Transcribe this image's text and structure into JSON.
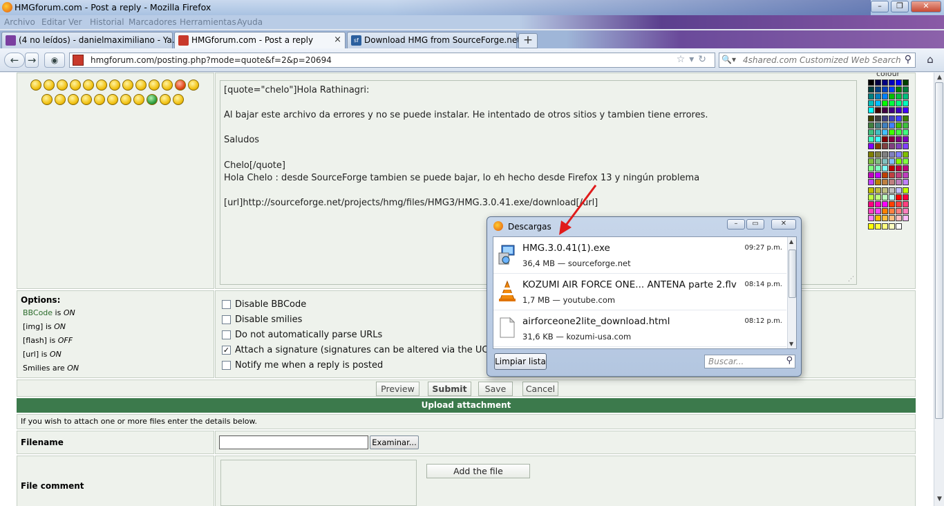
{
  "window": {
    "title": "HMGforum.com - Post a reply - Mozilla Firefox"
  },
  "menu": [
    "Archivo",
    "Editar",
    "Ver",
    "Historial",
    "Marcadores",
    "Herramientas",
    "Ayuda"
  ],
  "tabs": [
    {
      "label": "(4 no leídos) - danielmaximiliano - Ya...",
      "close": "×"
    },
    {
      "label": "HMGforum.com - Post a reply",
      "close": "×"
    },
    {
      "label": "Download HMG from SourceForge.net",
      "close": ""
    }
  ],
  "newtab_label": "+",
  "nav": {
    "url": "hmgforum.com/posting.php?mode=quote&f=2&p=20694",
    "search_placeholder": "4shared.com Customized Web Search"
  },
  "editor": {
    "colour_label": "colour",
    "lines": [
      "[quote=\"chelo\"]Hola Rathinagri:",
      "",
      "Al bajar este archivo da errores y no se puede instalar. He intentado de otros sitios y tambien tiene errores.",
      "",
      "Saludos",
      "",
      "Chelo[/quote]",
      "Hola Chelo : desde SourceForge tambien se puede bajar, lo eh hecho desde Firefox 13 y ningún problema",
      "",
      "[url]http://sourceforge.net/projects/hmg/files/HMG3/HMG.3.0.41.exe/download[/url]"
    ]
  },
  "options": {
    "title": "Options:",
    "bbcode_link": "BBCode",
    "bbcode_rest": " is ",
    "bbcode_state": "ON",
    "img": "[img] is ",
    "img_state": "ON",
    "flash": "[flash] is ",
    "flash_state": "OFF",
    "url": "[url] is ",
    "url_state": "ON",
    "smilies": "Smilies are ",
    "smilies_state": "ON",
    "checks": [
      {
        "label": "Disable BBCode",
        "checked": false
      },
      {
        "label": "Disable smilies",
        "checked": false
      },
      {
        "label": "Do not automatically parse URLs",
        "checked": false
      },
      {
        "label": "Attach a signature (signatures can be altered via the UCP",
        "checked": true
      },
      {
        "label": "Notify me when a reply is posted",
        "checked": false
      }
    ],
    "check_mark": "✓"
  },
  "buttons": {
    "preview": "Preview",
    "submit": "Submit",
    "save": "Save",
    "cancel": "Cancel"
  },
  "upload": {
    "header": "Upload attachment",
    "hint": "If you wish to attach one or more files enter the details below.",
    "filename_label": "Filename",
    "browse": "Examinar...",
    "comment_label": "File comment",
    "add_file": "Add the file"
  },
  "downloads": {
    "title": "Descargas",
    "items": [
      {
        "name": "HMG.3.0.41(1).exe",
        "info": "36,4 MB — sourceforge.net",
        "time": "09:27 p.m."
      },
      {
        "name": "KOZUMI AIR FORCE ONE... ANTENA parte 2.flv",
        "info": "1,7 MB — youtube.com",
        "time": "08:14 p.m."
      },
      {
        "name": "airforceone2lite_download.html",
        "info": "31,6 KB — kozumi-usa.com",
        "time": "08:12 p.m."
      }
    ],
    "clear": "Limpiar lista",
    "search_placeholder": "Buscar..."
  },
  "colors": {
    "accent_green": "#3c7a4c",
    "link_green": "#2a6b2a",
    "arrow_red": "#e01b1b"
  }
}
